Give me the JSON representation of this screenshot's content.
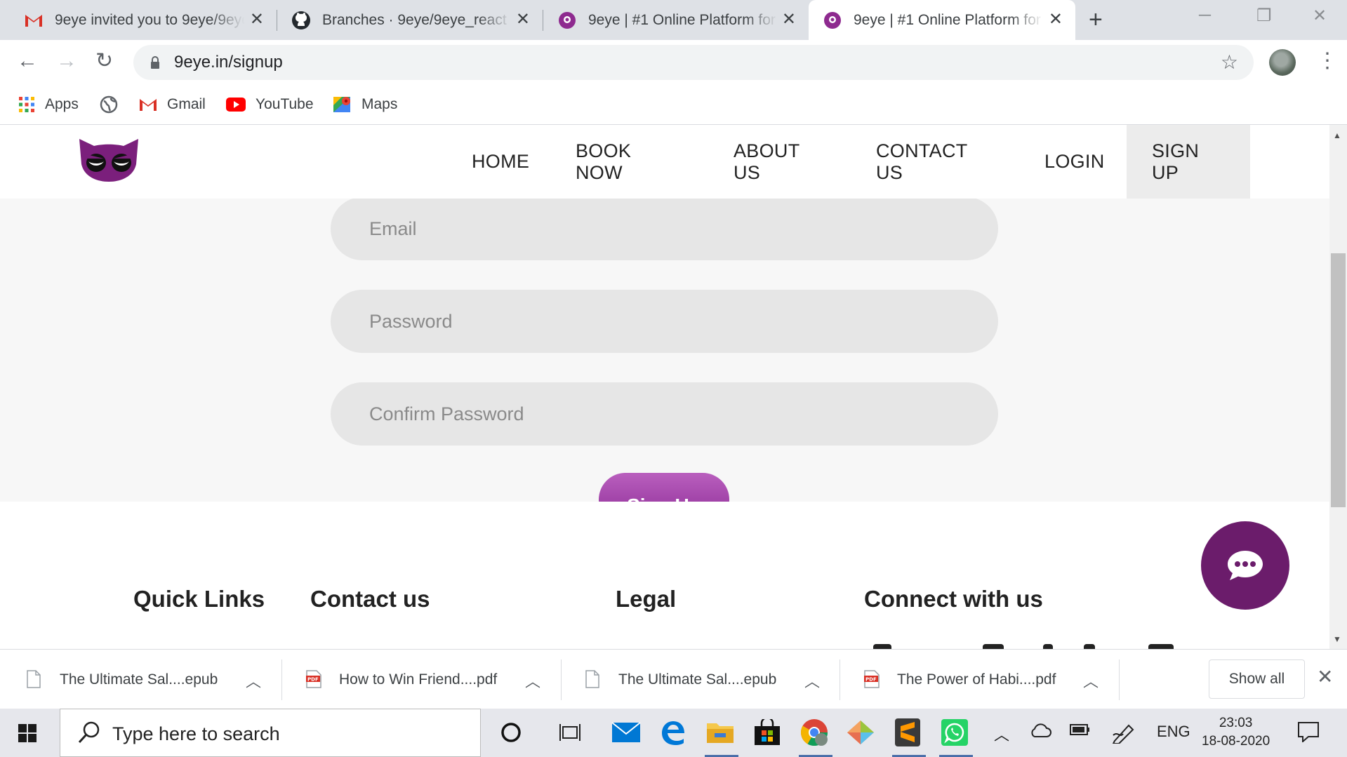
{
  "browser": {
    "tabs": [
      {
        "title": "9eye invited you to 9eye/9eye_react",
        "favicon": "gmail-icon",
        "active": false
      },
      {
        "title": "Branches · 9eye/9eye_react",
        "favicon": "github-icon",
        "active": false
      },
      {
        "title": "9eye | #1 Online Platform for",
        "favicon": "9eye-icon",
        "active": false
      },
      {
        "title": "9eye | #1 Online Platform for",
        "favicon": "9eye-icon",
        "active": true
      }
    ],
    "url": "9eye.in/signup",
    "bookmarks": [
      {
        "label": "Apps",
        "icon": "apps-grid-icon"
      },
      {
        "label": "",
        "icon": "globe-icon"
      },
      {
        "label": "Gmail",
        "icon": "gmail-icon"
      },
      {
        "label": "YouTube",
        "icon": "youtube-icon"
      },
      {
        "label": "Maps",
        "icon": "maps-icon"
      }
    ]
  },
  "site": {
    "nav": [
      {
        "label": "HOME",
        "active": false
      },
      {
        "label": "BOOK NOW",
        "active": false
      },
      {
        "label": "ABOUT US",
        "active": false
      },
      {
        "label": "CONTACT US",
        "active": false
      },
      {
        "label": "LOGIN",
        "active": false
      },
      {
        "label": "SIGN UP",
        "active": true
      }
    ],
    "form": {
      "email_placeholder": "Email",
      "password_placeholder": "Password",
      "confirm_placeholder": "Confirm Password",
      "submit_label": "Sign Up"
    },
    "footer": {
      "quick_links": "Quick Links",
      "contact": "Contact us",
      "legal": "Legal",
      "connect": "Connect with us"
    },
    "brand_color": "#6b1c6b"
  },
  "downloads": {
    "items": [
      {
        "name": "The Ultimate Sal....epub",
        "type": "epub"
      },
      {
        "name": "How to Win Friend....pdf",
        "type": "pdf"
      },
      {
        "name": "The Ultimate Sal....epub",
        "type": "epub"
      },
      {
        "name": "The Power of Habi....pdf",
        "type": "pdf"
      }
    ],
    "show_all": "Show all"
  },
  "taskbar": {
    "search_placeholder": "Type here to search",
    "language": "ENG",
    "time": "23:03",
    "date": "18-08-2020"
  }
}
